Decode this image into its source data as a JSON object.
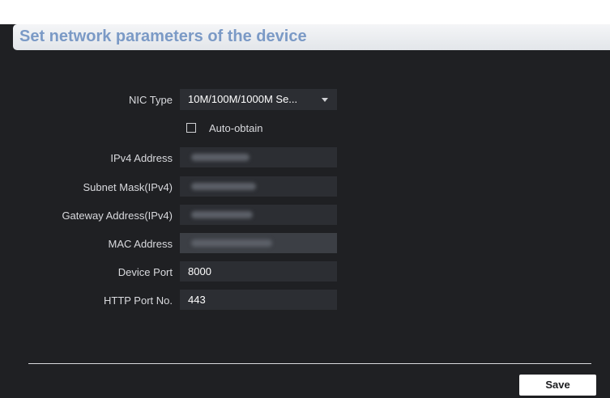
{
  "header": {
    "title": "Set network parameters of the device"
  },
  "form": {
    "nic_type": {
      "label": "NIC Type",
      "value": "10M/100M/1000M Se..."
    },
    "auto_obtain": {
      "label": "Auto-obtain",
      "checked": false
    },
    "ipv4_address": {
      "label": "IPv4 Address"
    },
    "subnet_mask": {
      "label": "Subnet Mask(IPv4)"
    },
    "gateway": {
      "label": "Gateway Address(IPv4)"
    },
    "mac_address": {
      "label": "MAC Address"
    },
    "device_port": {
      "label": "Device Port",
      "value": "8000"
    },
    "http_port": {
      "label": "HTTP Port No.",
      "value": "443"
    }
  },
  "footer": {
    "save_label": "Save"
  },
  "colors": {
    "background": "#1f2023",
    "field": "#2c2e33",
    "title": "#7b9ac6"
  },
  "icons": {
    "dropdown": "caret-down-icon"
  }
}
